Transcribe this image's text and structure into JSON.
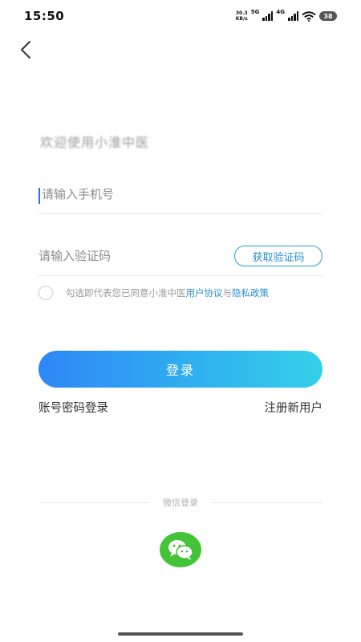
{
  "status_bar": {
    "time": "15:50",
    "net_speed_value": "30.3",
    "net_speed_unit": "KB/s",
    "net_type_1": "5G",
    "net_type_2": "4G",
    "battery": "38"
  },
  "welcome_text": "欢迎使用小淮中医",
  "phone_input": {
    "placeholder": "请输入手机号",
    "value": ""
  },
  "code_input": {
    "placeholder": "请输入验证码",
    "value": ""
  },
  "get_code_label": "获取验证码",
  "agreement": {
    "prefix": "勾选即代表您已同意小淮中医",
    "user_agreement": "用户协议",
    "and": "与",
    "privacy_policy": "隐私政策"
  },
  "login_label": "登录",
  "password_login_label": "账号密码登录",
  "register_label": "注册新用户",
  "wechat_login_label": "微信登录",
  "colors": {
    "accent": "#2a8fd0",
    "gradient_start": "#2f86f6",
    "gradient_end": "#35d0e8",
    "wechat_green": "#43c338"
  }
}
